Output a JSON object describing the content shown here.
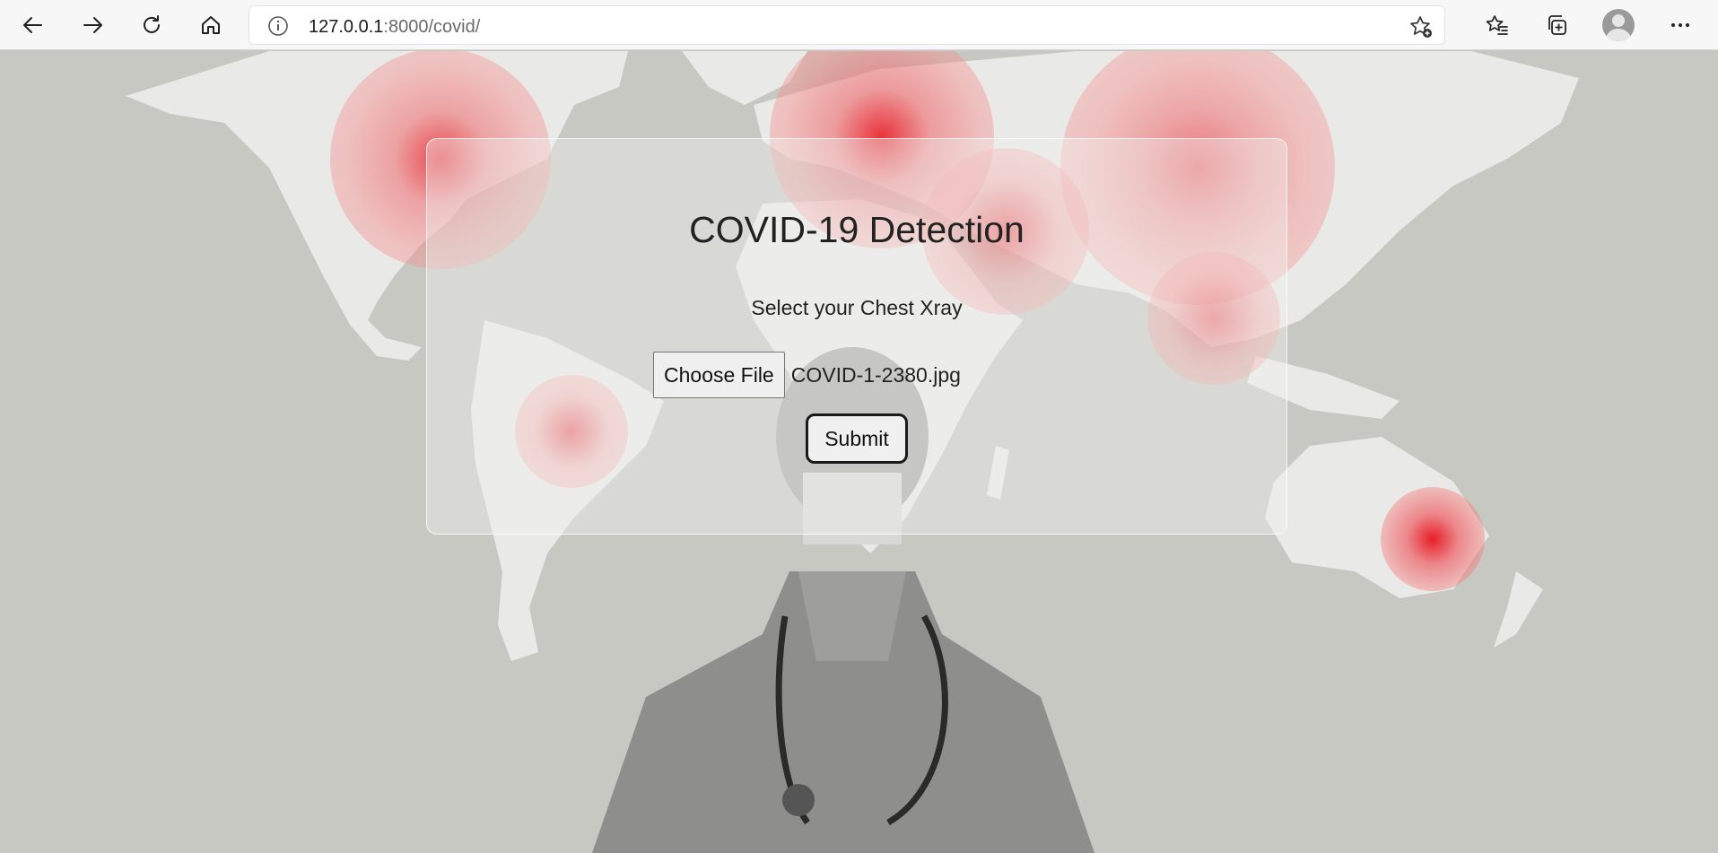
{
  "browser": {
    "url_host": "127.0.0.1",
    "url_rest": ":8000/covid/",
    "icons": [
      "back-icon",
      "forward-icon",
      "refresh-icon",
      "home-icon",
      "info-icon",
      "add-favorite-icon",
      "favorites-icon",
      "collections-icon",
      "profile-avatar",
      "more-icon"
    ]
  },
  "page": {
    "title": "COVID-19 Detection",
    "prompt": "Select your Chest Xray",
    "choose_file_label": "Choose File",
    "selected_file": "COVID-1-2380.jpg",
    "submit_label": "Submit"
  },
  "colors": {
    "background": "#c6c8c1",
    "land": "#e9eae7",
    "hotspot": "#e8141e"
  }
}
